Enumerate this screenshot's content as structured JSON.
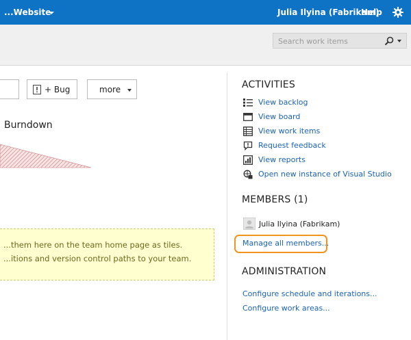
{
  "header": {
    "project_name": "...Website",
    "user_name": "Julia Ilyina (Fabrikam)",
    "help_label": "Help",
    "brand_color": "#0f73c5"
  },
  "search": {
    "placeholder": "Search work items"
  },
  "toolbar": {
    "bug_label": "+ Bug",
    "more_label": "more"
  },
  "burndown": {
    "title": "Burndown"
  },
  "tip": {
    "line1": "...them here on the team home page as tiles.",
    "line2": "...itions and version control paths to your team."
  },
  "activities": {
    "heading": "ACTIVITIES",
    "items": [
      {
        "label": "View backlog",
        "icon": "backlog-list-icon"
      },
      {
        "label": "View board",
        "icon": "board-icon"
      },
      {
        "label": "View work items",
        "icon": "work-items-grid-icon"
      },
      {
        "label": "Request feedback",
        "icon": "feedback-bubble-icon"
      },
      {
        "label": "View reports",
        "icon": "reports-icon"
      },
      {
        "label": "Open new instance of Visual Studio",
        "icon": "visual-studio-icon"
      }
    ]
  },
  "members": {
    "heading": "MEMBERS (1)",
    "list": [
      {
        "name": "Julia Ilyina (Fabrikam)"
      }
    ],
    "manage_label": "Manage all members...",
    "highlight_color": "#f2931c"
  },
  "administration": {
    "heading": "ADMINISTRATION",
    "links": [
      {
        "label": "Configure schedule and iterations..."
      },
      {
        "label": "Configure work areas..."
      }
    ]
  },
  "colors": {
    "link": "#1a62b5",
    "tip_background": "#ffffd0",
    "tip_text": "#6a6a1c"
  }
}
